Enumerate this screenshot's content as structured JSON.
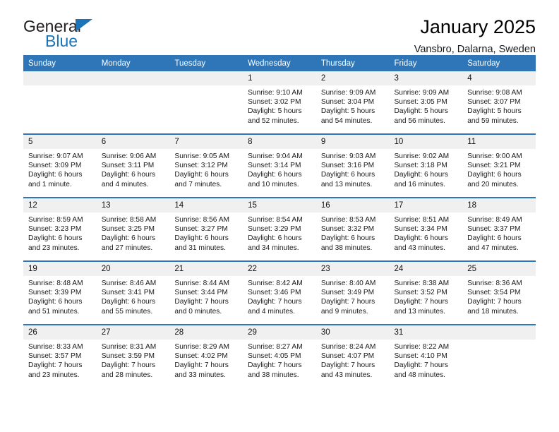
{
  "brand": {
    "name_top": "General",
    "name_bottom": "Blue",
    "accent_color": "#1b73b8"
  },
  "header": {
    "title": "January 2025",
    "subtitle": "Vansbro, Dalarna, Sweden"
  },
  "calendar": {
    "header_bg": "#2e76b8",
    "daynum_bg": "#f0f0f0",
    "weekday_headers": [
      "Sunday",
      "Monday",
      "Tuesday",
      "Wednesday",
      "Thursday",
      "Friday",
      "Saturday"
    ],
    "labels": {
      "sunrise": "Sunrise:",
      "sunset": "Sunset:",
      "daylight": "Daylight:"
    },
    "weeks": [
      [
        {
          "day": "",
          "empty": true
        },
        {
          "day": "",
          "empty": true
        },
        {
          "day": "",
          "empty": true
        },
        {
          "day": "1",
          "sunrise": "Sunrise: 9:10 AM",
          "sunset": "Sunset: 3:02 PM",
          "daylight_line1": "Daylight: 5 hours",
          "daylight_line2": "and 52 minutes."
        },
        {
          "day": "2",
          "sunrise": "Sunrise: 9:09 AM",
          "sunset": "Sunset: 3:04 PM",
          "daylight_line1": "Daylight: 5 hours",
          "daylight_line2": "and 54 minutes."
        },
        {
          "day": "3",
          "sunrise": "Sunrise: 9:09 AM",
          "sunset": "Sunset: 3:05 PM",
          "daylight_line1": "Daylight: 5 hours",
          "daylight_line2": "and 56 minutes."
        },
        {
          "day": "4",
          "sunrise": "Sunrise: 9:08 AM",
          "sunset": "Sunset: 3:07 PM",
          "daylight_line1": "Daylight: 5 hours",
          "daylight_line2": "and 59 minutes."
        }
      ],
      [
        {
          "day": "5",
          "sunrise": "Sunrise: 9:07 AM",
          "sunset": "Sunset: 3:09 PM",
          "daylight_line1": "Daylight: 6 hours",
          "daylight_line2": "and 1 minute."
        },
        {
          "day": "6",
          "sunrise": "Sunrise: 9:06 AM",
          "sunset": "Sunset: 3:11 PM",
          "daylight_line1": "Daylight: 6 hours",
          "daylight_line2": "and 4 minutes."
        },
        {
          "day": "7",
          "sunrise": "Sunrise: 9:05 AM",
          "sunset": "Sunset: 3:12 PM",
          "daylight_line1": "Daylight: 6 hours",
          "daylight_line2": "and 7 minutes."
        },
        {
          "day": "8",
          "sunrise": "Sunrise: 9:04 AM",
          "sunset": "Sunset: 3:14 PM",
          "daylight_line1": "Daylight: 6 hours",
          "daylight_line2": "and 10 minutes."
        },
        {
          "day": "9",
          "sunrise": "Sunrise: 9:03 AM",
          "sunset": "Sunset: 3:16 PM",
          "daylight_line1": "Daylight: 6 hours",
          "daylight_line2": "and 13 minutes."
        },
        {
          "day": "10",
          "sunrise": "Sunrise: 9:02 AM",
          "sunset": "Sunset: 3:18 PM",
          "daylight_line1": "Daylight: 6 hours",
          "daylight_line2": "and 16 minutes."
        },
        {
          "day": "11",
          "sunrise": "Sunrise: 9:00 AM",
          "sunset": "Sunset: 3:21 PM",
          "daylight_line1": "Daylight: 6 hours",
          "daylight_line2": "and 20 minutes."
        }
      ],
      [
        {
          "day": "12",
          "sunrise": "Sunrise: 8:59 AM",
          "sunset": "Sunset: 3:23 PM",
          "daylight_line1": "Daylight: 6 hours",
          "daylight_line2": "and 23 minutes."
        },
        {
          "day": "13",
          "sunrise": "Sunrise: 8:58 AM",
          "sunset": "Sunset: 3:25 PM",
          "daylight_line1": "Daylight: 6 hours",
          "daylight_line2": "and 27 minutes."
        },
        {
          "day": "14",
          "sunrise": "Sunrise: 8:56 AM",
          "sunset": "Sunset: 3:27 PM",
          "daylight_line1": "Daylight: 6 hours",
          "daylight_line2": "and 31 minutes."
        },
        {
          "day": "15",
          "sunrise": "Sunrise: 8:54 AM",
          "sunset": "Sunset: 3:29 PM",
          "daylight_line1": "Daylight: 6 hours",
          "daylight_line2": "and 34 minutes."
        },
        {
          "day": "16",
          "sunrise": "Sunrise: 8:53 AM",
          "sunset": "Sunset: 3:32 PM",
          "daylight_line1": "Daylight: 6 hours",
          "daylight_line2": "and 38 minutes."
        },
        {
          "day": "17",
          "sunrise": "Sunrise: 8:51 AM",
          "sunset": "Sunset: 3:34 PM",
          "daylight_line1": "Daylight: 6 hours",
          "daylight_line2": "and 43 minutes."
        },
        {
          "day": "18",
          "sunrise": "Sunrise: 8:49 AM",
          "sunset": "Sunset: 3:37 PM",
          "daylight_line1": "Daylight: 6 hours",
          "daylight_line2": "and 47 minutes."
        }
      ],
      [
        {
          "day": "19",
          "sunrise": "Sunrise: 8:48 AM",
          "sunset": "Sunset: 3:39 PM",
          "daylight_line1": "Daylight: 6 hours",
          "daylight_line2": "and 51 minutes."
        },
        {
          "day": "20",
          "sunrise": "Sunrise: 8:46 AM",
          "sunset": "Sunset: 3:41 PM",
          "daylight_line1": "Daylight: 6 hours",
          "daylight_line2": "and 55 minutes."
        },
        {
          "day": "21",
          "sunrise": "Sunrise: 8:44 AM",
          "sunset": "Sunset: 3:44 PM",
          "daylight_line1": "Daylight: 7 hours",
          "daylight_line2": "and 0 minutes."
        },
        {
          "day": "22",
          "sunrise": "Sunrise: 8:42 AM",
          "sunset": "Sunset: 3:46 PM",
          "daylight_line1": "Daylight: 7 hours",
          "daylight_line2": "and 4 minutes."
        },
        {
          "day": "23",
          "sunrise": "Sunrise: 8:40 AM",
          "sunset": "Sunset: 3:49 PM",
          "daylight_line1": "Daylight: 7 hours",
          "daylight_line2": "and 9 minutes."
        },
        {
          "day": "24",
          "sunrise": "Sunrise: 8:38 AM",
          "sunset": "Sunset: 3:52 PM",
          "daylight_line1": "Daylight: 7 hours",
          "daylight_line2": "and 13 minutes."
        },
        {
          "day": "25",
          "sunrise": "Sunrise: 8:36 AM",
          "sunset": "Sunset: 3:54 PM",
          "daylight_line1": "Daylight: 7 hours",
          "daylight_line2": "and 18 minutes."
        }
      ],
      [
        {
          "day": "26",
          "sunrise": "Sunrise: 8:33 AM",
          "sunset": "Sunset: 3:57 PM",
          "daylight_line1": "Daylight: 7 hours",
          "daylight_line2": "and 23 minutes."
        },
        {
          "day": "27",
          "sunrise": "Sunrise: 8:31 AM",
          "sunset": "Sunset: 3:59 PM",
          "daylight_line1": "Daylight: 7 hours",
          "daylight_line2": "and 28 minutes."
        },
        {
          "day": "28",
          "sunrise": "Sunrise: 8:29 AM",
          "sunset": "Sunset: 4:02 PM",
          "daylight_line1": "Daylight: 7 hours",
          "daylight_line2": "and 33 minutes."
        },
        {
          "day": "29",
          "sunrise": "Sunrise: 8:27 AM",
          "sunset": "Sunset: 4:05 PM",
          "daylight_line1": "Daylight: 7 hours",
          "daylight_line2": "and 38 minutes."
        },
        {
          "day": "30",
          "sunrise": "Sunrise: 8:24 AM",
          "sunset": "Sunset: 4:07 PM",
          "daylight_line1": "Daylight: 7 hours",
          "daylight_line2": "and 43 minutes."
        },
        {
          "day": "31",
          "sunrise": "Sunrise: 8:22 AM",
          "sunset": "Sunset: 4:10 PM",
          "daylight_line1": "Daylight: 7 hours",
          "daylight_line2": "and 48 minutes."
        },
        {
          "day": "",
          "empty": true
        }
      ]
    ]
  }
}
